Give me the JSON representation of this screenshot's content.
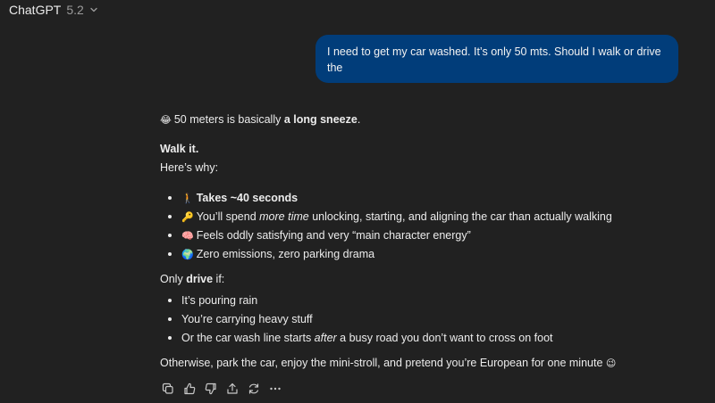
{
  "header": {
    "app_name": "ChatGPT",
    "model_version": "5.2"
  },
  "user_message": {
    "text": "I need to get my car washed. It’s only 50 mts. Should I walk or drive the"
  },
  "assistant": {
    "intro": {
      "emoji": "😂",
      "text_before": "50 meters is basically ",
      "text_bold": "a long sneeze",
      "text_after": "."
    },
    "verdict": "Walk it.",
    "why_label": "Here’s why:",
    "reasons": [
      {
        "emoji": "🚶",
        "segments": [
          {
            "t": "Takes ~40 seconds",
            "style": "bold"
          }
        ]
      },
      {
        "emoji": "🔑",
        "segments": [
          {
            "t": "You’ll spend ",
            "style": ""
          },
          {
            "t": "more time",
            "style": "italic"
          },
          {
            "t": " unlocking, starting, and aligning the car than actually walking",
            "style": ""
          }
        ]
      },
      {
        "emoji": "🧠",
        "segments": [
          {
            "t": "Feels oddly satisfying and very “main character energy”",
            "style": ""
          }
        ]
      },
      {
        "emoji": "🌍",
        "segments": [
          {
            "t": "Zero emissions, zero parking drama",
            "style": ""
          }
        ]
      }
    ],
    "only_drive": {
      "before": "Only ",
      "bold": "drive",
      "after": " if:"
    },
    "drive_conditions": [
      {
        "segments": [
          {
            "t": "It’s pouring rain",
            "style": ""
          }
        ]
      },
      {
        "segments": [
          {
            "t": "You’re carrying heavy stuff",
            "style": ""
          }
        ]
      },
      {
        "segments": [
          {
            "t": "Or the car wash line starts ",
            "style": ""
          },
          {
            "t": "after",
            "style": "italic"
          },
          {
            "t": " a busy road you don’t want to cross on foot",
            "style": ""
          }
        ]
      }
    ],
    "closing": {
      "text": "Otherwise, park the car, enjoy the mini-stroll, and pretend you’re European for one minute",
      "emoji": "😉"
    }
  },
  "toolbar": {
    "icons": [
      "copy-icon",
      "thumbs-up-icon",
      "thumbs-down-icon",
      "share-icon",
      "regenerate-icon",
      "more-icon"
    ]
  }
}
